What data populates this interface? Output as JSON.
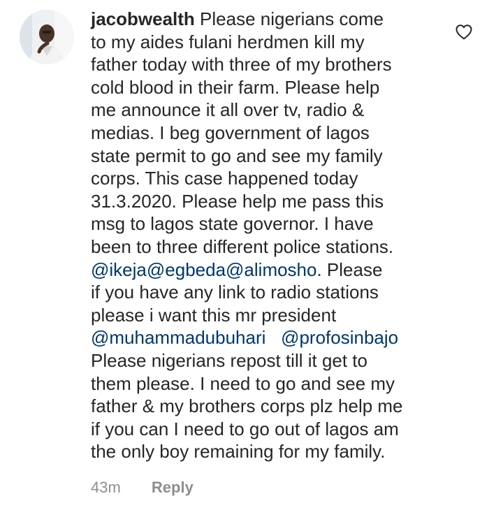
{
  "comment": {
    "username": "jacobwealth",
    "lines": [
      " Please nigerians come",
      "to my aides fulani herdmen kill my",
      "father today with three of my brothers",
      "cold blood in their farm. Please help",
      "me announce it all over tv, radio &",
      "medias. I beg government of lagos",
      "state permit to go and see my family",
      "corps. This case happened today",
      "31.3.2020. Please help me pass this",
      "msg to lagos state governor. I have",
      "been to three different police stations."
    ],
    "line12": {
      "mention_1": "@ikeja",
      "mention_2": "@egbeda",
      "mention_3": "@alimosho",
      "rest": ". Please"
    },
    "lines_after_1": [
      "if you have any link to radio stations",
      "please i want this mr president"
    ],
    "line15": {
      "mention_1": "@muhammadubuhari",
      "mention_2": "@profosinbajo"
    },
    "lines_after_2": [
      "Please nigerians repost till it get to",
      "them please. I need to go and see my",
      "father & my brothers corps plz help me",
      "if you can I need to go out of lagos am",
      "the only boy remaining for my family."
    ],
    "time": "43m",
    "reply_label": "Reply",
    "icons": {
      "avatar": "profile-photo",
      "like": "heart-outline-icon"
    },
    "colors": {
      "text": "#262626",
      "mention": "#00376b",
      "meta": "#8e8e8e"
    }
  }
}
